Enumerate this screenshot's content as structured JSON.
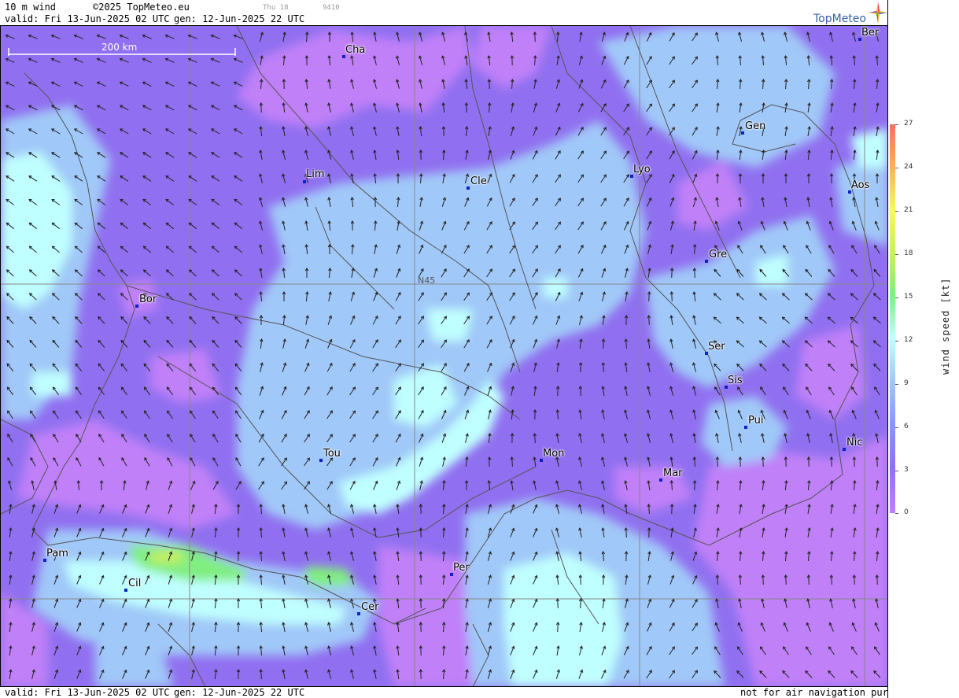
{
  "header": {
    "parameter": "10 m wind",
    "copyright": "©2025 TopMeteo.eu",
    "day_small": "Thu 18",
    "code_small": "9410",
    "valid": "valid:  Fri  13-Jun-2025  02 UTC",
    "generated": "gen: 12-Jun-2025 22 UTC"
  },
  "logo": {
    "text": "TopMeteo"
  },
  "scale": {
    "label": "200 km"
  },
  "grid": {
    "label": "N45"
  },
  "cities": [
    {
      "label": "Cha"
    },
    {
      "label": "Ber"
    },
    {
      "label": "Gen"
    },
    {
      "label": "Lim"
    },
    {
      "label": "Cle"
    },
    {
      "label": "Lyo"
    },
    {
      "label": "Aos"
    },
    {
      "label": "Gre"
    },
    {
      "label": "Bor"
    },
    {
      "label": "Ser"
    },
    {
      "label": "Sis"
    },
    {
      "label": "Pui"
    },
    {
      "label": "Tou"
    },
    {
      "label": "Mon"
    },
    {
      "label": "Nic"
    },
    {
      "label": "Mar"
    },
    {
      "label": "Pam"
    },
    {
      "label": "Per"
    },
    {
      "label": "Cil"
    },
    {
      "label": "Cer"
    }
  ],
  "footer": {
    "valid": "valid:  Fri  13-Jun-2025  02 UTC",
    "generated": "gen: 12-Jun-2025 22 UTC",
    "disclaimer": "not for air navigation purposes"
  },
  "legend": {
    "title": "wind speed [kt]",
    "ticks": [
      "27",
      "24",
      "21",
      "18",
      "15",
      "12",
      "9",
      "6",
      "3",
      "0"
    ],
    "colors": {
      "c0": "#c080f8",
      "c3": "#9070f0",
      "c6": "#8898f8",
      "c9": "#a0c8f8",
      "c12": "#c0ffff",
      "c15": "#80ee80",
      "c18": "#c8f060",
      "c21": "#f8f860",
      "c24": "#f8b060",
      "c27": "#f87060"
    }
  }
}
